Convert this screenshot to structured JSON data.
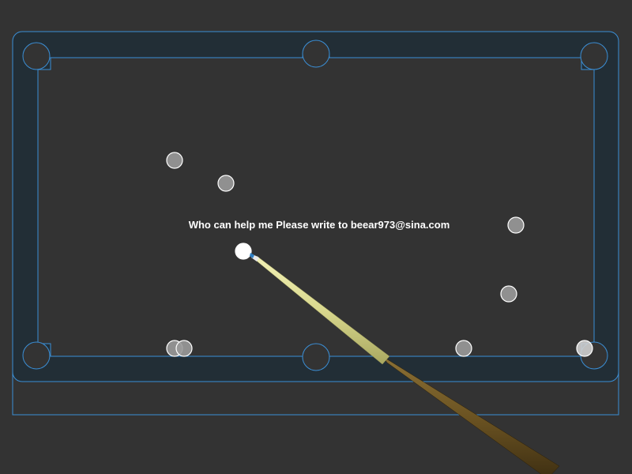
{
  "message": "Who can help me Please write to beear973@sina.com",
  "colors": {
    "background": "#333333",
    "rail_fill": "#222e36",
    "rail_line": "#3b8fd6",
    "felt": "#333333",
    "cue_ball": "#ffffff",
    "object_ball": "#9a9a9a",
    "ball_outline": "#ffffff",
    "cue_shaft": "#d9d88e",
    "cue_butt": "#6b5322",
    "cue_tip": "#2e7fc4"
  },
  "balls": [
    {
      "name": "cue-ball",
      "type": "cue"
    },
    {
      "name": "object-ball-1",
      "type": "object"
    },
    {
      "name": "object-ball-2",
      "type": "object"
    },
    {
      "name": "object-ball-3",
      "type": "object"
    },
    {
      "name": "object-ball-4",
      "type": "object"
    },
    {
      "name": "object-ball-5",
      "type": "object"
    },
    {
      "name": "object-ball-6",
      "type": "object"
    },
    {
      "name": "object-ball-7",
      "type": "object"
    },
    {
      "name": "object-ball-8",
      "type": "object"
    }
  ],
  "pockets": [
    "top-left",
    "top-middle",
    "top-right",
    "bottom-left",
    "bottom-middle",
    "bottom-right"
  ]
}
